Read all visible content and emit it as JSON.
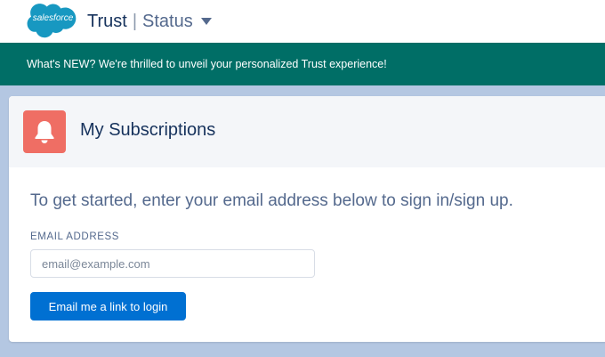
{
  "header": {
    "logo_text": "salesforce",
    "title": "Trust",
    "separator": "|",
    "subtitle": "Status",
    "caret_icon": "caret-down-icon"
  },
  "banner": {
    "text": "What's NEW? We're thrilled to unveil your personalized Trust experience!"
  },
  "card": {
    "icon": "bell-icon",
    "title": "My Subscriptions",
    "intro": "To get started, enter your email address below to sign in/sign up.",
    "email_label": "EMAIL ADDRESS",
    "email_placeholder": "email@example.com",
    "email_value": "",
    "button_label": "Email me a link to login"
  },
  "colors": {
    "page_background": "#b4c7e2",
    "banner_background": "#006e66",
    "logo_blue": "#1798c1",
    "bell_background": "#ef6e64",
    "button_blue": "#0070d2",
    "title_text": "#16325c"
  }
}
